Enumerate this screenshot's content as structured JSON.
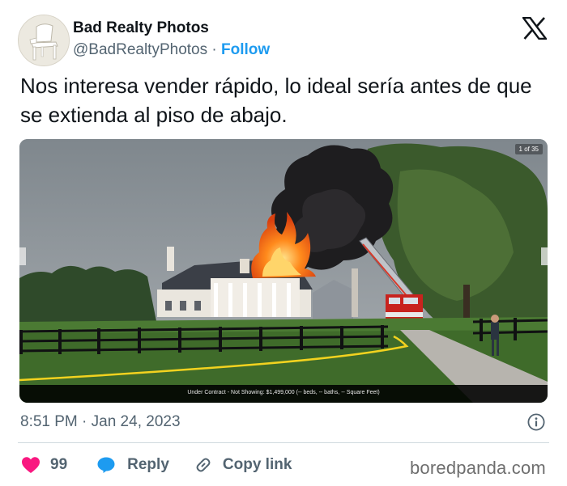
{
  "header": {
    "display_name": "Bad Realty Photos",
    "handle": "@BadRealtyPhotos",
    "separator": "·",
    "follow_label": "Follow",
    "platform_icon": "x-logo-icon",
    "avatar_icon": "white-plastic-chair-avatar"
  },
  "tweet": {
    "text": "Nos interesa vender rápido, lo ideal sería antes de que se extienda al piso de abajo."
  },
  "media": {
    "description_icon": "house-on-fire-photo",
    "counter": "1 of 35",
    "caption": "Under Contract - Not Showing: $1,499,000 (-- beds, -- baths, -- Square Feet)"
  },
  "meta": {
    "timestamp": "8:51 PM · Jan 24, 2023",
    "info_icon": "info-icon"
  },
  "actions": {
    "like_count": "99",
    "reply_label": "Reply",
    "copy_label": "Copy link",
    "like_color": "#f91880",
    "reply_color": "#1d9bf0"
  },
  "watermark": "boredpanda.com",
  "colors": {
    "accent": "#1d9bf0",
    "text": "#0f1419",
    "muted": "#536471",
    "like": "#f91880"
  }
}
